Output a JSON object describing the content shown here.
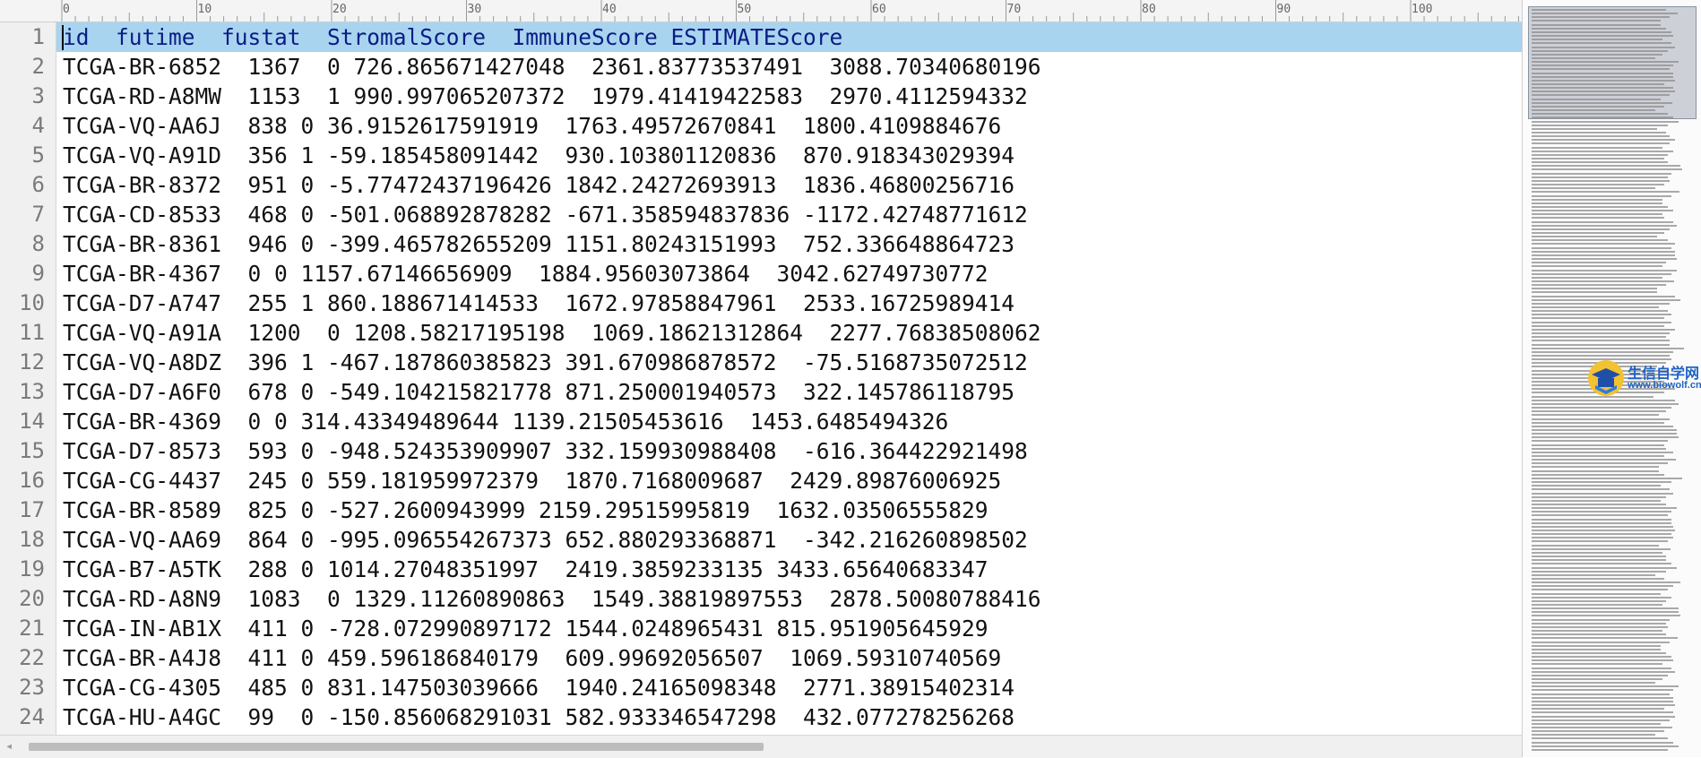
{
  "ruler": {
    "labels": [
      "0",
      "10",
      "20",
      "30",
      "40",
      "50",
      "60",
      "70",
      "80",
      "90",
      "100"
    ]
  },
  "lines": [
    "id  futime  fustat  StromalScore  ImmuneScore ESTIMATEScore",
    "TCGA-BR-6852  1367  0 726.865671427048  2361.83773537491  3088.70340680196",
    "TCGA-RD-A8MW  1153  1 990.997065207372  1979.41419422583  2970.4112594332",
    "TCGA-VQ-AA6J  838 0 36.9152617591919  1763.49572670841  1800.4109884676",
    "TCGA-VQ-A91D  356 1 -59.185458091442  930.103801120836  870.918343029394",
    "TCGA-BR-8372  951 0 -5.77472437196426 1842.24272693913  1836.46800256716",
    "TCGA-CD-8533  468 0 -501.068892878282 -671.358594837836 -1172.42748771612",
    "TCGA-BR-8361  946 0 -399.465782655209 1151.80243151993  752.336648864723",
    "TCGA-BR-4367  0 0 1157.67146656909  1884.95603073864  3042.62749730772",
    "TCGA-D7-A747  255 1 860.188671414533  1672.97858847961  2533.16725989414",
    "TCGA-VQ-A91A  1200  0 1208.58217195198  1069.18621312864  2277.76838508062",
    "TCGA-VQ-A8DZ  396 1 -467.187860385823 391.670986878572  -75.5168735072512",
    "TCGA-D7-A6F0  678 0 -549.104215821778 871.250001940573  322.145786118795",
    "TCGA-BR-4369  0 0 314.43349489644 1139.21505453616  1453.6485494326",
    "TCGA-D7-8573  593 0 -948.524353909907 332.159930988408  -616.364422921498",
    "TCGA-CG-4437  245 0 559.181959972379  1870.7168009687  2429.89876006925",
    "TCGA-BR-8589  825 0 -527.2600943999 2159.29515995819  1632.03506555829",
    "TCGA-VQ-AA69  864 0 -995.096554267373 652.880293368871  -342.216260898502",
    "TCGA-B7-A5TK  288 0 1014.27048351997  2419.3859233135 3433.65640683347",
    "TCGA-RD-A8N9  1083  0 1329.11260890863  1549.38819897553  2878.50080788416",
    "TCGA-IN-AB1X  411 0 -728.072990897172 1544.0248965431 815.951905645929",
    "TCGA-BR-A4J8  411 0 459.596186840179  609.99692056507  1069.59310740569",
    "TCGA-CG-4305  485 0 831.147503039666  1940.24165098348  2771.38915402314",
    "TCGA-HU-A4GC  99  0 -150.856068291031 582.933346547298  432.077278256268"
  ],
  "line_numbers": [
    "1",
    "2",
    "3",
    "4",
    "5",
    "6",
    "7",
    "8",
    "9",
    "10",
    "11",
    "12",
    "13",
    "14",
    "15",
    "16",
    "17",
    "18",
    "19",
    "20",
    "21",
    "22",
    "23",
    "24"
  ],
  "watermark": {
    "title": "生信自学网",
    "url": "www.biowolf.cn"
  },
  "colors": {
    "current_line": "#a9d4ef",
    "header_text": "#0b1c86",
    "watermark": "#1f63c4"
  }
}
